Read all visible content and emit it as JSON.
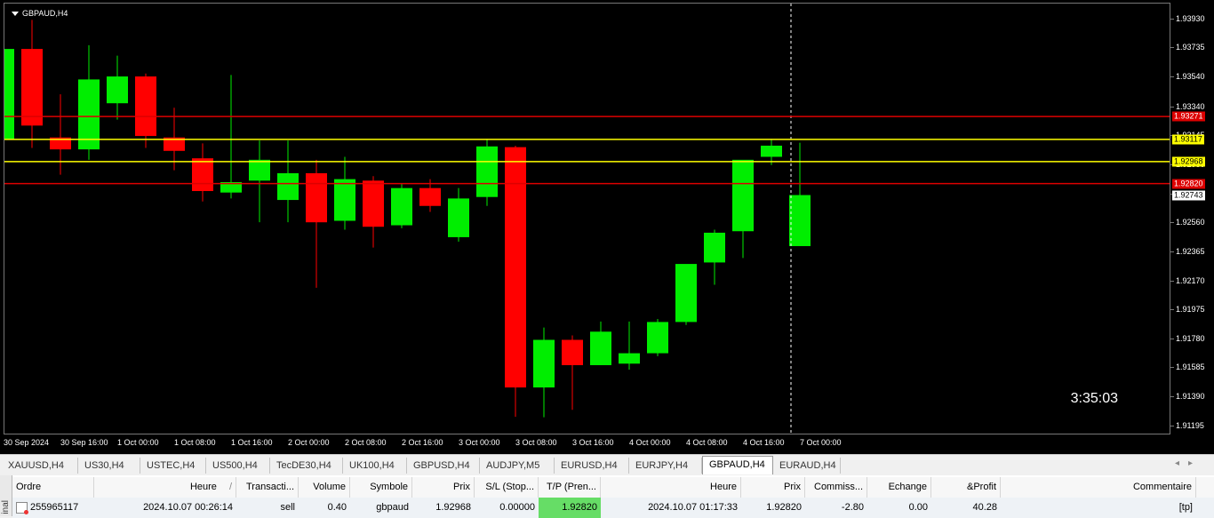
{
  "chart": {
    "symbol_label": "GBPAUD,H4",
    "countdown": "3:35:03",
    "price_scale": {
      "ticks": [
        "1.93930",
        "1.93735",
        "1.93540",
        "1.93340",
        "1.93145",
        "1.92950",
        "1.92755",
        "1.92560",
        "1.92365",
        "1.92170",
        "1.91975",
        "1.91780",
        "1.91585",
        "1.91390",
        "1.91195"
      ]
    },
    "time_labels": [
      "30 Sep 2024",
      "30 Sep 16:00",
      "1 Oct 00:00",
      "1 Oct 08:00",
      "1 Oct 16:00",
      "2 Oct 00:00",
      "2 Oct 08:00",
      "2 Oct 16:00",
      "3 Oct 00:00",
      "3 Oct 08:00",
      "3 Oct 16:00",
      "4 Oct 00:00",
      "4 Oct 08:00",
      "4 Oct 16:00",
      "7 Oct 00:00"
    ],
    "price_labels": [
      {
        "text": "1.93271",
        "price": 1.93271,
        "bg": "#dd0000",
        "fg": "#ffffff",
        "line": true
      },
      {
        "text": "1.93117",
        "price": 1.93117,
        "bg": "#ffff00",
        "fg": "#000000",
        "line": true
      },
      {
        "text": "1.92968",
        "price": 1.92968,
        "bg": "#ffff00",
        "fg": "#000000",
        "line": true
      },
      {
        "text": "1.92820",
        "price": 1.9282,
        "bg": "#dd0000",
        "fg": "#ffffff",
        "line": true
      },
      {
        "text": "1.92743",
        "price": 1.92743,
        "bg": "#ffffff",
        "fg": "#000000",
        "line": false
      }
    ],
    "colors": {
      "bull": "#00ee00",
      "bear": "#ff0000",
      "background": "#000000",
      "line_red": "#dd0000",
      "line_yellow": "#ffff00"
    }
  },
  "chart_data": {
    "type": "candlestick",
    "symbol": "GBPAUD",
    "timeframe": "H4",
    "ylim": [
      1.9114,
      1.9403
    ],
    "candles": [
      {
        "o": 1.93117,
        "h": 1.9375,
        "l": 1.9295,
        "c": 1.93725
      },
      {
        "o": 1.93725,
        "h": 1.9392,
        "l": 1.9306,
        "c": 1.9321
      },
      {
        "o": 1.9313,
        "h": 1.9342,
        "l": 1.9288,
        "c": 1.9305
      },
      {
        "o": 1.9305,
        "h": 1.9375,
        "l": 1.9298,
        "c": 1.9352
      },
      {
        "o": 1.9336,
        "h": 1.9368,
        "l": 1.9325,
        "c": 1.9354
      },
      {
        "o": 1.9354,
        "h": 1.9356,
        "l": 1.9306,
        "c": 1.9314
      },
      {
        "o": 1.9313,
        "h": 1.9333,
        "l": 1.9291,
        "c": 1.9304
      },
      {
        "o": 1.9299,
        "h": 1.9309,
        "l": 1.927,
        "c": 1.9277
      },
      {
        "o": 1.9276,
        "h": 1.9355,
        "l": 1.9272,
        "c": 1.9283
      },
      {
        "o": 1.9284,
        "h": 1.9311,
        "l": 1.9256,
        "c": 1.9298
      },
      {
        "o": 1.9271,
        "h": 1.9311,
        "l": 1.9256,
        "c": 1.9289
      },
      {
        "o": 1.9289,
        "h": 1.9298,
        "l": 1.9212,
        "c": 1.9256
      },
      {
        "o": 1.9257,
        "h": 1.93,
        "l": 1.9251,
        "c": 1.9285
      },
      {
        "o": 1.9284,
        "h": 1.9287,
        "l": 1.9239,
        "c": 1.9253
      },
      {
        "o": 1.9254,
        "h": 1.9282,
        "l": 1.9252,
        "c": 1.9279
      },
      {
        "o": 1.9279,
        "h": 1.9285,
        "l": 1.9263,
        "c": 1.9267
      },
      {
        "o": 1.9246,
        "h": 1.9279,
        "l": 1.9243,
        "c": 1.9272
      },
      {
        "o": 1.9273,
        "h": 1.9312,
        "l": 1.9267,
        "c": 1.9307
      },
      {
        "o": 1.93065,
        "h": 1.93075,
        "l": 1.91253,
        "c": 1.9145
      },
      {
        "o": 1.9145,
        "h": 1.91853,
        "l": 1.9125,
        "c": 1.9177
      },
      {
        "o": 1.9177,
        "h": 1.918,
        "l": 1.913,
        "c": 1.916
      },
      {
        "o": 1.916,
        "h": 1.91893,
        "l": 1.916,
        "c": 1.91825
      },
      {
        "o": 1.9161,
        "h": 1.91893,
        "l": 1.9157,
        "c": 1.9168
      },
      {
        "o": 1.9168,
        "h": 1.9191,
        "l": 1.9166,
        "c": 1.9189
      },
      {
        "o": 1.9189,
        "h": 1.9213,
        "l": 1.9187,
        "c": 1.9228
      },
      {
        "o": 1.9229,
        "h": 1.9251,
        "l": 1.9214,
        "c": 1.9249
      },
      {
        "o": 1.925,
        "h": 1.9288,
        "l": 1.9232,
        "c": 1.9298
      },
      {
        "o": 1.93,
        "h": 1.93117,
        "l": 1.92945,
        "c": 1.93075
      },
      {
        "o": 1.924,
        "h": 1.93095,
        "l": 1.924,
        "c": 1.92743
      }
    ]
  },
  "tabs": {
    "items": [
      "XAUUSD,H4",
      "US30,H4",
      "USTEC,H4",
      "US500,H4",
      "TecDE30,H4",
      "UK100,H4",
      "GBPUSD,H4",
      "AUDJPY,M5",
      "EURUSD,H4",
      "EURJPY,H4",
      "GBPAUD,H4",
      "EURAUD,H4"
    ],
    "active": "GBPAUD,H4",
    "scroll_left": "◂",
    "scroll_right": "▸"
  },
  "terminal": {
    "side_label": "inal",
    "columns": [
      "Ordre",
      "Heure",
      "Transacti...",
      "Volume",
      "Symbole",
      "Prix",
      "S/L (Stop...",
      "T/P (Pren...",
      "Heure",
      "Prix",
      "Commiss...",
      "Echange",
      "&Profit",
      "Commentaire"
    ],
    "sort_indicator": "/",
    "row": {
      "order": "255965117",
      "time": "2024.10.07 00:26:14",
      "type": "sell",
      "volume": "0.40",
      "symbol": "gbpaud",
      "price": "1.92968",
      "sl": "0.00000",
      "tp": "1.92820",
      "close_time": "2024.10.07 01:17:33",
      "close_price": "1.92820",
      "commission": "-2.80",
      "swap": "0.00",
      "profit": "40.28",
      "comment": "[tp]"
    }
  }
}
